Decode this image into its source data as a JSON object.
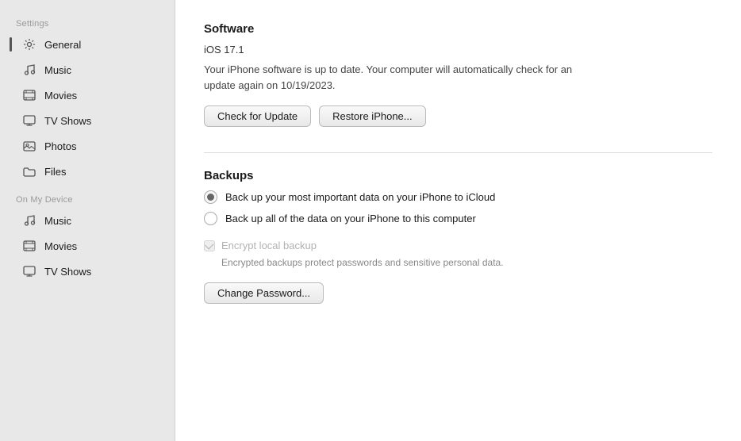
{
  "sidebar": {
    "settings_label": "Settings",
    "on_device_label": "On My Device",
    "items_settings": [
      {
        "id": "general",
        "label": "General",
        "icon": "gear",
        "active": true
      },
      {
        "id": "music",
        "label": "Music",
        "icon": "music"
      },
      {
        "id": "movies",
        "label": "Movies",
        "icon": "film"
      },
      {
        "id": "tv-shows",
        "label": "TV Shows",
        "icon": "tv"
      },
      {
        "id": "photos",
        "label": "Photos",
        "icon": "photo"
      },
      {
        "id": "files",
        "label": "Files",
        "icon": "folder"
      }
    ],
    "items_device": [
      {
        "id": "device-music",
        "label": "Music",
        "icon": "music"
      },
      {
        "id": "device-movies",
        "label": "Movies",
        "icon": "film"
      },
      {
        "id": "device-tv-shows",
        "label": "TV Shows",
        "icon": "tv"
      }
    ]
  },
  "main": {
    "software": {
      "section_title": "Software",
      "version": "iOS 17.1",
      "description": "Your iPhone software is up to date. Your computer will automatically check for an update again on 10/19/2023.",
      "check_update_btn": "Check for Update",
      "restore_btn": "Restore iPhone..."
    },
    "backups": {
      "section_title": "Backups",
      "options": [
        {
          "id": "icloud",
          "label": "Back up your most important data on your iPhone to iCloud",
          "selected": true
        },
        {
          "id": "computer",
          "label": "Back up all of the data on your iPhone to this computer",
          "selected": false
        }
      ],
      "encrypt_label": "Encrypt local backup",
      "encrypt_description": "Encrypted backups protect passwords and sensitive personal data.",
      "change_password_btn": "Change Password..."
    }
  }
}
